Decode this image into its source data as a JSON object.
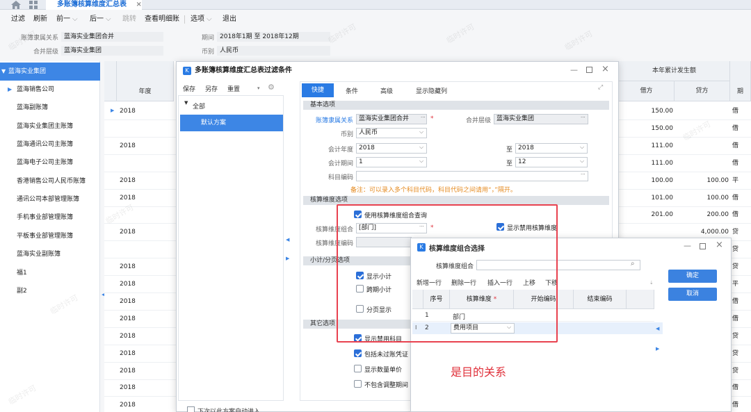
{
  "tabbar": {
    "active_tab": "多账簿核算维度汇总表",
    "close": "×"
  },
  "toolbar": {
    "items": [
      "过滤",
      "刷新",
      "前一",
      "后一",
      "跳转",
      "查看明细账",
      "选项",
      "退出"
    ]
  },
  "info": {
    "ledger_lbl": "账簿隶属关系",
    "ledger_val": "蓝海实业集团合并",
    "merge_lbl": "合并层级",
    "merge_val": "蓝海实业集团",
    "period_lbl": "期间",
    "period_val": "2018年1期 至 2018年12期",
    "currency_lbl": "币别",
    "currency_val": "人民币"
  },
  "leftnav": {
    "items": [
      "蓝海实业集团",
      "蓝海销售公司",
      "蓝海副账簿",
      "蓝海实业集团主账簿",
      "蓝海通讯公司主账簿",
      "蓝海电子公司主账簿",
      "香港销售公司人民币账簿",
      "通讯公司本部管理账簿",
      "手机事业部管理账簿",
      "平板事业部管理账簿",
      "蓝海实业副账簿",
      "福1",
      "副2"
    ]
  },
  "grid": {
    "year_header": "年度",
    "cum_header": "本年累计发生额",
    "debit": "借方",
    "credit": "贷方",
    "dir_header": "期",
    "years": [
      "2018",
      "",
      "2018",
      "",
      "2018",
      "2018",
      "",
      "2018",
      "",
      "2018",
      "2018",
      "2018",
      "2018",
      "2018",
      "2018",
      "2018",
      "2018",
      "2018"
    ],
    "debits": [
      "150.00",
      "150.00",
      "111.00",
      "111.00",
      "100.00",
      "101.00",
      "201.00",
      "",
      "",
      "",
      "",
      "",
      "",
      "",
      "",
      "",
      "",
      ""
    ],
    "credits": [
      "",
      "",
      "",
      "",
      "100.00",
      "100.00",
      "200.00",
      "4,000.00",
      "",
      "",
      "",
      "",
      "",
      "",
      "",
      "",
      "",
      ""
    ],
    "dirs": [
      "借",
      "借",
      "借",
      "借",
      "平",
      "借",
      "借",
      "贷",
      "贷",
      "贷",
      "平",
      "借",
      "借",
      "贷",
      "贷",
      "贷",
      "借",
      "借"
    ]
  },
  "dialog": {
    "title": "多账簿核算维度汇总表过滤条件",
    "save": "保存",
    "save_as": "另存",
    "reset": "重置",
    "tree_all": "全部",
    "scheme": "默认方案",
    "tabs": [
      "快捷",
      "条件",
      "高级",
      "显示隐藏列"
    ],
    "sec_basic": "基本选项",
    "ledger_lbl": "账簿隶属关系",
    "ledger_val": "蓝海实业集团合并",
    "merge_lbl": "合并层级",
    "merge_val": "蓝海实业集团",
    "cur_lbl": "币别",
    "cur_val": "人民币",
    "year_lbl": "会计年度",
    "year_from": "2018",
    "to": "至",
    "year_to": "2018",
    "period_lbl": "会计期间",
    "period_from": "1",
    "period_to": "12",
    "acct_lbl": "科目编码",
    "note": "备注：可以录入多个科目代码，科目代码之间请用“，”隔开。",
    "sec_dim": "核算维度选项",
    "use_combo": "使用核算维度组合查询",
    "combo_lbl": "核算维度组合",
    "combo_val": "[部门]",
    "show_disabled_dim": "显示禁用核算维度",
    "dimcode_lbl": "核算维度编码",
    "sec_sub": "小计/分页选项",
    "show_subtotal": "显示小计",
    "cross_period": "跨期小计",
    "paging": "分页显示",
    "sec_other": "其它选项",
    "show_disabled_acct": "显示禁用科目",
    "include_unposted": "包括未过账凭证",
    "show_qty_price": "显示数量单价",
    "exclude_adjust": "不包含调整期间",
    "auto_enter": "下次以此方案自动进入",
    "required": "*",
    "more": "···"
  },
  "dialog2": {
    "title": "核算维度组合选择",
    "combo_lbl": "核算维度组合",
    "actions": [
      "新增一行",
      "删除一行",
      "插入一行",
      "上移",
      "下移"
    ],
    "ok": "确定",
    "cancel": "取消",
    "cols": [
      "序号",
      "核算维度",
      "开始编码",
      "结束编码"
    ],
    "required": "*",
    "rows": [
      {
        "no": "1",
        "dim": "部门"
      },
      {
        "no": "2",
        "dim": "费用项目"
      }
    ]
  },
  "annotation": {
    "text": "是目的关系",
    "color": "#e0303a"
  },
  "watermark": "临时许可",
  "colors": {
    "accent": "#2a7be4",
    "highlight": "#e0303a"
  }
}
